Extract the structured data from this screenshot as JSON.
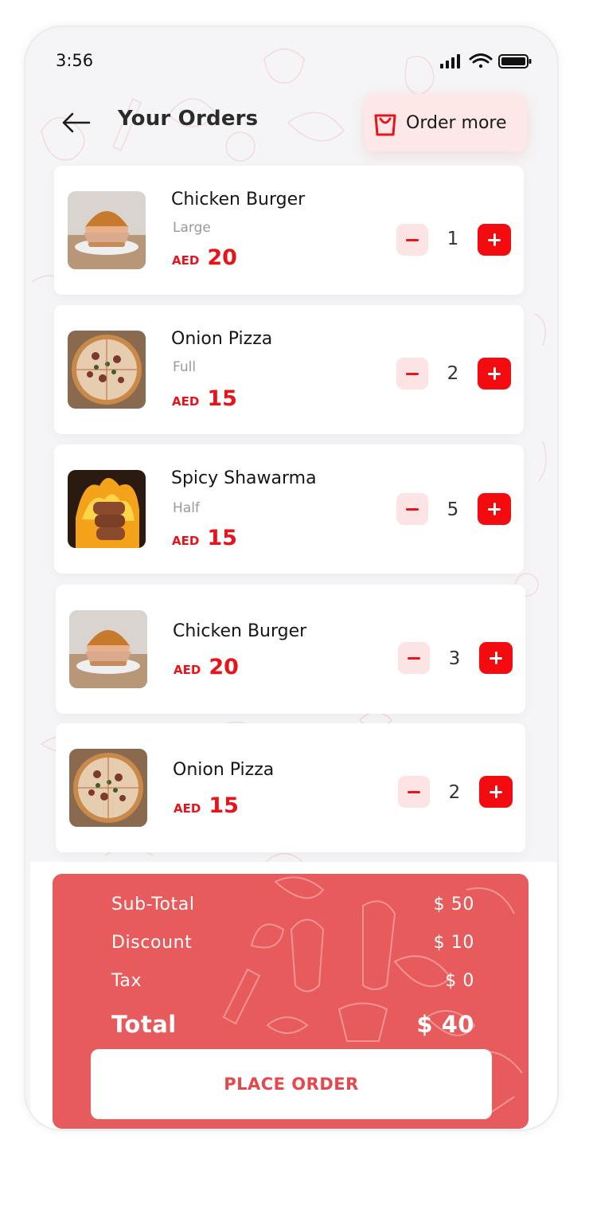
{
  "status_bar": {
    "time": "3:56"
  },
  "header": {
    "title": "Your Orders",
    "order_more_label": "Order more"
  },
  "currency_label": "AED",
  "orders": [
    {
      "name": "Chicken Burger",
      "size": "Large",
      "price": "20",
      "quantity": "1",
      "image": "burger"
    },
    {
      "name": "Onion Pizza",
      "size": "Full",
      "price": "15",
      "quantity": "2",
      "image": "pizza"
    },
    {
      "name": "Spicy Shawarma",
      "size": "Half",
      "price": "15",
      "quantity": "5",
      "image": "shawarma"
    },
    {
      "name": "Chicken Burger",
      "price": "20",
      "quantity": "3",
      "image": "burger"
    },
    {
      "name": "Onion Pizza",
      "price": "15",
      "quantity": "2",
      "image": "pizza"
    }
  ],
  "summary": {
    "subtotal_label": "Sub-Total",
    "subtotal_value": "$ 50",
    "discount_label": "Discount",
    "discount_value": "$ 10",
    "tax_label": "Tax",
    "tax_value": "$ 0",
    "total_label": "Total",
    "total_value": "$ 40",
    "place_order_label": "PLACE ORDER"
  },
  "colors": {
    "accent": "#f40b10",
    "summary_bg": "#e85b5d",
    "minus_bg": "#fde4e4"
  },
  "icons": [
    "back-arrow-icon",
    "shopping-bag-icon",
    "signal-icon",
    "wifi-icon",
    "battery-icon",
    "minus-icon",
    "plus-icon"
  ]
}
